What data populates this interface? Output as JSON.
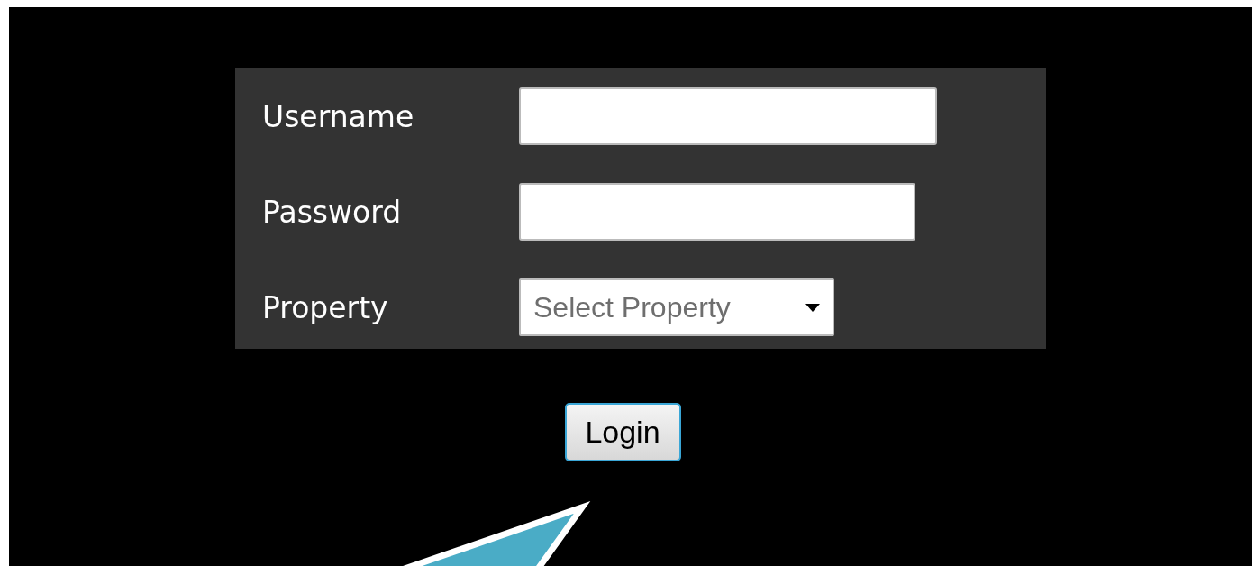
{
  "login_form": {
    "fields": [
      {
        "kind": "text",
        "label": "Username"
      },
      {
        "kind": "password",
        "label": "Password"
      },
      {
        "kind": "select",
        "label": "Property",
        "value": "Select Property"
      }
    ],
    "login_button": "Login"
  }
}
